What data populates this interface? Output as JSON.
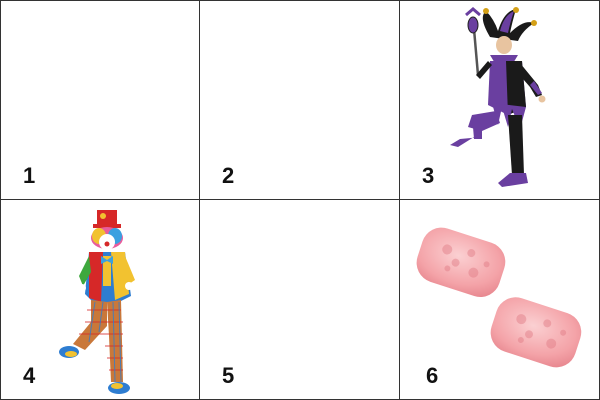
{
  "cells": [
    {
      "number": "1",
      "content": "empty"
    },
    {
      "number": "2",
      "content": "empty"
    },
    {
      "number": "3",
      "content": "jester-costume"
    },
    {
      "number": "4",
      "content": "clown-costume"
    },
    {
      "number": "5",
      "content": "empty"
    },
    {
      "number": "6",
      "content": "pink-candies"
    }
  ],
  "colors": {
    "grid_line": "#333333",
    "jester_purple": "#6a3fa0",
    "jester_black": "#1a1a1a",
    "clown_red": "#d62828",
    "clown_yellow": "#f2c230",
    "candy_pink": "#f4a3a8"
  }
}
